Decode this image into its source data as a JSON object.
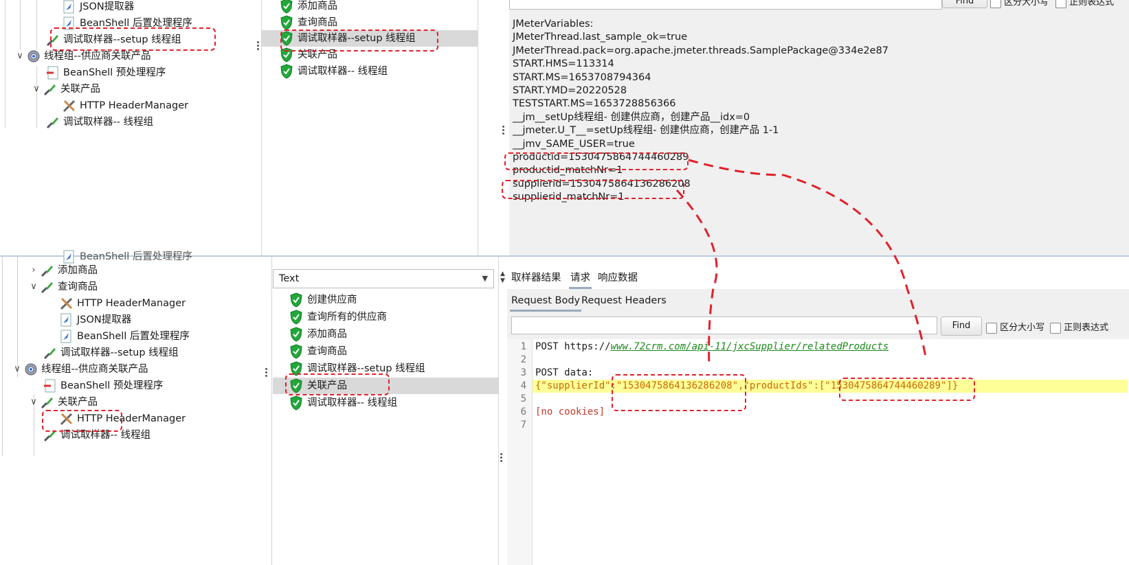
{
  "top_tree": {
    "items": [
      {
        "label": "JSON提取器",
        "icon": "json-extractor-icon"
      },
      {
        "label": "BeanShell 后置处理程序",
        "icon": "beanshell-icon"
      },
      {
        "label": "调试取样器--setup 线程组",
        "icon": "sampler-icon"
      },
      {
        "label": "线程组--供应商关联产品",
        "icon": "gear-icon"
      },
      {
        "label": "BeanShell 预处理程序",
        "icon": "beanshell-pre-icon"
      },
      {
        "label": "关联产品",
        "icon": "sampler-icon"
      },
      {
        "label": "HTTP HeaderManager",
        "icon": "tools-icon"
      },
      {
        "label": "调试取样器-- 线程组",
        "icon": "sampler-icon"
      }
    ]
  },
  "top_results": {
    "items": [
      "添加商品",
      "查询商品",
      "调试取样器--setup 线程组",
      "关联产品",
      "调试取样器-- 线程组"
    ]
  },
  "top_search": {
    "find_label": "Find",
    "case_label": "区分大小写",
    "regex_label": "正则表达式"
  },
  "vars": {
    "lines": [
      "JMeterVariables:",
      "JMeterThread.last_sample_ok=true",
      "JMeterThread.pack=org.apache.jmeter.threads.SamplePackage@334e2e87",
      "START.HMS=113314",
      "START.MS=1653708794364",
      "START.YMD=20220528",
      "TESTSTART.MS=1653728856366",
      "__jm__setUp线程组- 创建供应商，创建产品__idx=0",
      "__jmeter.U_T__=setUp线程组- 创建供应商，创建产品 1-1",
      "__jmv_SAME_USER=true",
      "productid=1530475864744460289",
      "productid_matchNr=1",
      "supplierid=1530475864136286208",
      "supplierid_matchNr=1"
    ]
  },
  "bottom_tree": {
    "items": [
      {
        "label": "BeanShell 后置处理程序",
        "icon": "beanshell-icon"
      },
      {
        "label": "添加商品",
        "icon": "sampler-icon"
      },
      {
        "label": "查询商品",
        "icon": "sampler-icon"
      },
      {
        "label": "HTTP HeaderManager",
        "icon": "tools-icon"
      },
      {
        "label": "JSON提取器",
        "icon": "json-extractor-icon"
      },
      {
        "label": "BeanShell 后置处理程序",
        "icon": "beanshell-icon"
      },
      {
        "label": "调试取样器--setup 线程组",
        "icon": "sampler-icon"
      },
      {
        "label": "线程组--供应商关联产品",
        "icon": "gear-icon"
      },
      {
        "label": "BeanShell 预处理程序",
        "icon": "beanshell-pre-icon"
      },
      {
        "label": "关联产品",
        "icon": "sampler-icon"
      },
      {
        "label": "HTTP HeaderManager",
        "icon": "tools-icon"
      },
      {
        "label": "调试取样器-- 线程组",
        "icon": "sampler-icon"
      }
    ]
  },
  "renderer": {
    "selected": "Text"
  },
  "bottom_results": {
    "items": [
      "创建供应商",
      "查询所有的供应商",
      "添加商品",
      "查询商品",
      "调试取样器--setup 线程组",
      "关联产品",
      "调试取样器-- 线程组"
    ]
  },
  "result_tabs": {
    "sampler_result": "取样器结果",
    "request": "请求",
    "response_data": "响应数据"
  },
  "request_tabs": {
    "body": "Request Body",
    "headers": "Request Headers"
  },
  "bottom_search": {
    "placeholder": "",
    "find_label": "Find",
    "case_label": "区分大小写",
    "regex_label": "正则表达式"
  },
  "request_body": {
    "line_numbers": [
      "1",
      "2",
      "3",
      "4",
      "5",
      "6",
      "7"
    ],
    "method": "POST",
    "url_prefix": "https://",
    "url_link": "www.72crm.com/api-11/jxcSupplier/relatedProducts",
    "post_data_label": "POST data:",
    "json_line": "{\"supplierId\":\"1530475864136286208\",\"productIds\":[\"1530475864744460289\"]}",
    "no_cookies": "[no cookies]"
  },
  "colors": {
    "annotation": "#e0202a",
    "highlight": "#ffff99",
    "success": "#22a83a",
    "link": "#1a8a1a"
  }
}
